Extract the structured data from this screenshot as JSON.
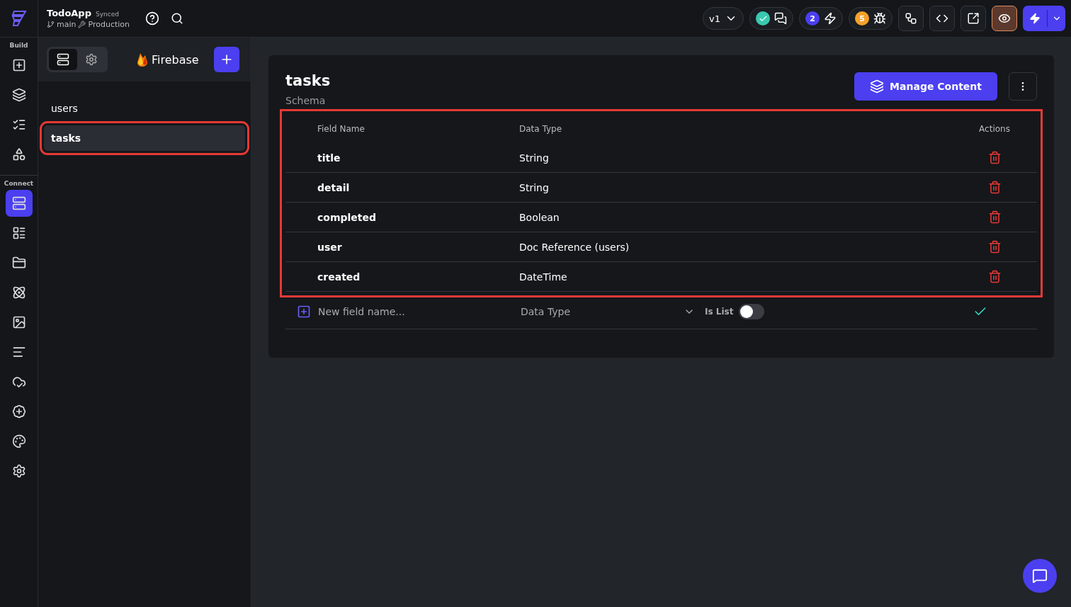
{
  "app": {
    "name": "TodoApp",
    "sync_status": "Synced",
    "branch": "main",
    "environment": "Production"
  },
  "toolbar": {
    "version": "v1",
    "badges": [
      {
        "kind": "check"
      },
      {
        "kind": "count",
        "count": "2",
        "color": "#4b3ff0"
      },
      {
        "kind": "count",
        "count": "5",
        "color": "#f5a02a"
      }
    ],
    "tools": [
      {
        "kind": "branch"
      },
      {
        "kind": "code"
      },
      {
        "kind": "export"
      }
    ],
    "preview_on": true
  },
  "rail": [
    {
      "label": "Build",
      "items": [
        {
          "kind": "add-widget",
          "selected": false
        },
        {
          "kind": "pages",
          "selected": false
        },
        {
          "kind": "list",
          "selected": false
        },
        {
          "kind": "assets",
          "selected": false
        }
      ]
    },
    {
      "label": "Connect",
      "items": [
        {
          "kind": "database",
          "selected": true
        },
        {
          "kind": "schema",
          "selected": false
        },
        {
          "kind": "folder",
          "selected": false
        },
        {
          "kind": "integrations",
          "selected": false
        },
        {
          "kind": "media",
          "selected": false
        },
        {
          "kind": "align",
          "selected": false
        },
        {
          "kind": "cloud",
          "selected": false
        },
        {
          "kind": "tests",
          "selected": false
        },
        {
          "kind": "theme",
          "selected": false
        },
        {
          "kind": "settings",
          "selected": false
        }
      ]
    }
  ],
  "panel": {
    "tabs": [
      {
        "kind": "database",
        "selected": true
      },
      {
        "kind": "settings",
        "selected": false
      }
    ],
    "provider": "Firebase",
    "collections": [
      {
        "name": "users",
        "selected": false,
        "highlighted": false
      },
      {
        "name": "tasks",
        "selected": true,
        "highlighted": true
      }
    ]
  },
  "content": {
    "title": "tasks",
    "subtitle": "Schema",
    "manage_button": "Manage Content",
    "table_highlighted": true,
    "columns": [
      "Field Name",
      "Data Type",
      "Actions"
    ],
    "rows": [
      {
        "name": "title",
        "type": "String"
      },
      {
        "name": "detail",
        "type": "String"
      },
      {
        "name": "completed",
        "type": "Boolean"
      },
      {
        "name": "user",
        "type": "Doc Reference (users)"
      },
      {
        "name": "created",
        "type": "DateTime"
      }
    ],
    "new_field": {
      "placeholder": "New field name...",
      "type_placeholder": "Data Type",
      "is_list_label": "Is List",
      "is_list": false
    }
  }
}
